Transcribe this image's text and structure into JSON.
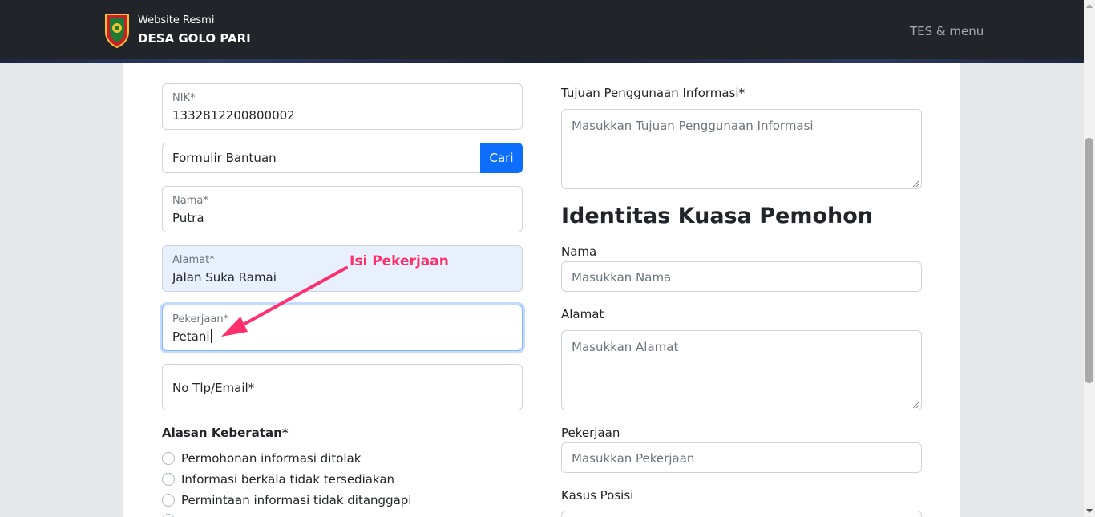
{
  "header": {
    "site_subtitle": "Website Resmi",
    "site_name": "DESA GOLO PARI",
    "menu_label": "TES & menu"
  },
  "left_form": {
    "nik": {
      "label": "NIK*",
      "value": "1332812200800002"
    },
    "formulir": {
      "value": "Formulir Bantuan",
      "button_label": "Cari"
    },
    "nama": {
      "label": "Nama*",
      "value": "Putra"
    },
    "alamat": {
      "label": "Alamat*",
      "value": "Jalan Suka Ramai"
    },
    "pekerjaan": {
      "label": "Pekerjaan*",
      "value": "Petani"
    },
    "kontak": {
      "label": "No Tlp/Email*"
    },
    "alasan": {
      "title": "Alasan Keberatan*",
      "options": [
        "Permohonan informasi ditolak",
        "Informasi berkala tidak tersediakan",
        "Permintaan informasi tidak ditanggapi"
      ]
    }
  },
  "right_form": {
    "tujuan": {
      "label": "Tujuan Penggunaan Informasi*",
      "placeholder": "Masukkan Tujuan Penggunaan Informasi"
    },
    "section_title": "Identitas Kuasa Pemohon",
    "nama": {
      "label": "Nama",
      "placeholder": "Masukkan Nama"
    },
    "alamat": {
      "label": "Alamat",
      "placeholder": "Masukkan Alamat"
    },
    "pekerjaan": {
      "label": "Pekerjaan",
      "placeholder": "Masukkan Pekerjaan"
    },
    "kasus": {
      "label": "Kasus Posisi"
    }
  },
  "annotation": {
    "text": "Isi Pekerjaan",
    "color": "#ff2e6e"
  },
  "colors": {
    "navbar": "#212529",
    "primary": "#0d6efd",
    "autofill": "#e8f0fe"
  },
  "icons": {
    "logo": "village-emblem-icon"
  }
}
